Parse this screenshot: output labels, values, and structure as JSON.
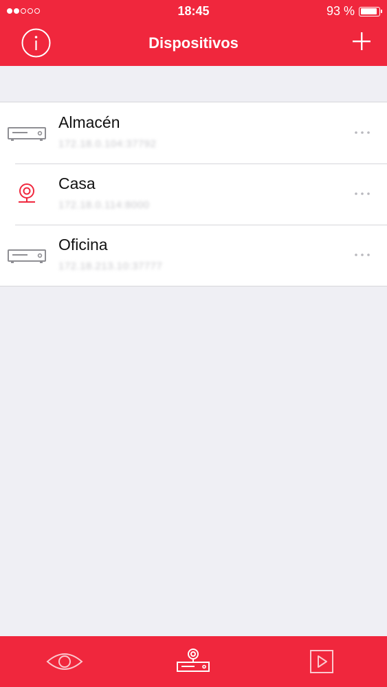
{
  "status_bar": {
    "time": "18:45",
    "battery_text": "93 %",
    "battery_level": 0.93,
    "signal_bars_filled": 2,
    "signal_bars_total": 5
  },
  "nav": {
    "title": "Dispositivos",
    "info_icon": "info-circle-icon",
    "add_icon": "plus-icon"
  },
  "devices": [
    {
      "name": "Almacén",
      "address": "172.18.0.104:37792",
      "type": "dvr",
      "icon": "dvr-recorder-icon",
      "color": "#8e8e93"
    },
    {
      "name": "Casa",
      "address": "172.18.0.114:8000",
      "type": "camera",
      "icon": "webcam-icon",
      "color": "#f0273d"
    },
    {
      "name": "Oficina",
      "address": "172.18.213.10:37777",
      "type": "dvr",
      "icon": "dvr-recorder-icon",
      "color": "#8e8e93"
    }
  ],
  "tabs": [
    {
      "id": "live",
      "icon": "eye-icon"
    },
    {
      "id": "devices",
      "icon": "device-camera-icon",
      "selected": true
    },
    {
      "id": "playback",
      "icon": "play-icon"
    }
  ],
  "colors": {
    "accent": "#f0273d",
    "background": "#efeff4",
    "separator": "#d6d6da",
    "icon_gray": "#8e8e93"
  }
}
